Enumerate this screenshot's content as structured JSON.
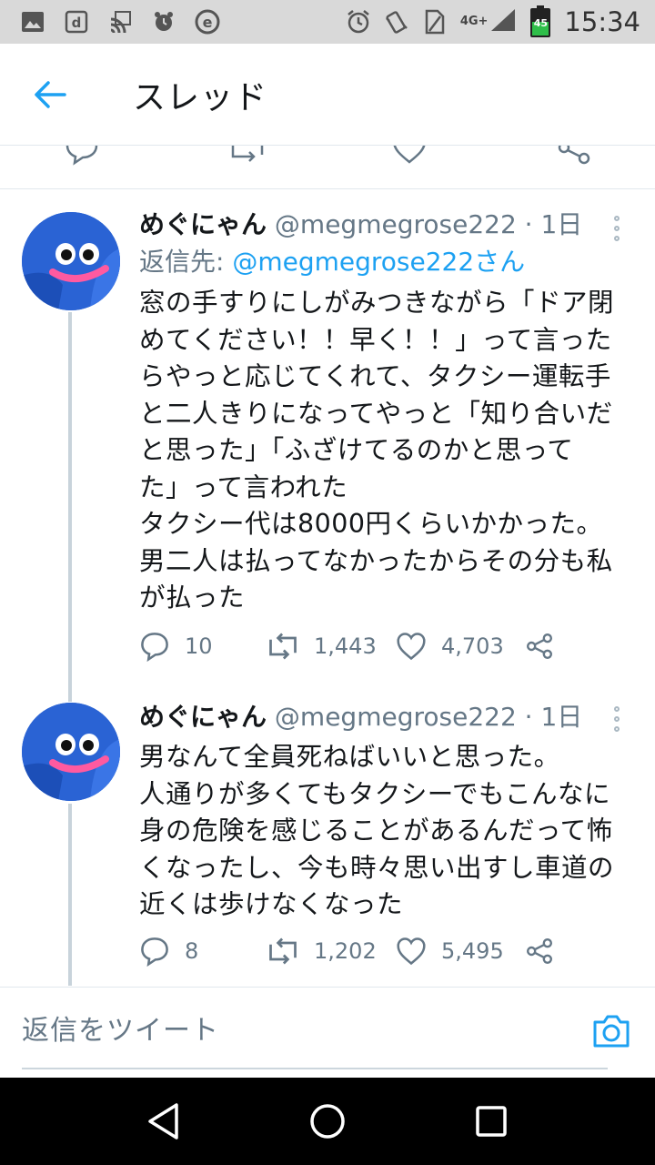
{
  "status_bar": {
    "time": "15:34",
    "network": "4G+",
    "battery": "45"
  },
  "header": {
    "title": "スレッド"
  },
  "tweets": [
    {
      "author_name": "めぐにゃん",
      "handle": "@megmegrose222",
      "time": "· 1日",
      "reply_label": "返信先:",
      "reply_handle": "@megmegrose222さん",
      "text": "窓の手すりにしがみつきながら「ドア閉\nめてください！！早く！！」って言った\nらやっと応じてくれて、タクシー運転手\nと二人きりになってやっと「知り合いだ\nと思った」「ふざけてるのかと思って\nた」って言われた\nタクシー代は8000円くらいかかった。\n男二人は払ってなかったからその分も私\nが払った",
      "replies": "10",
      "retweets": "1,443",
      "likes": "4,703"
    },
    {
      "author_name": "めぐにゃん",
      "handle": "@megmegrose222",
      "time": "· 1日",
      "text": "男なんて全員死ねばいいと思った。\n人通りが多くてもタクシーでもこんなに\n身の危険を感じることがあるんだって怖\nくなったし、今も時々思い出すし車道の\n近くは歩けなくなった",
      "replies": "8",
      "retweets": "1,202",
      "likes": "5,495"
    }
  ],
  "composer": {
    "placeholder": "返信をツイート"
  },
  "colors": {
    "accent": "#1da1f2",
    "text": "#14171a",
    "secondary": "#657786"
  },
  "icons": [
    "gallery-icon",
    "docomo-icon",
    "cast-icon",
    "alarm-icon",
    "e-icon",
    "alarm-clock-icon",
    "vibrate-icon",
    "sim-icon",
    "signal-icon",
    "battery-icon",
    "back-arrow-icon",
    "reply-icon",
    "retweet-icon",
    "like-icon",
    "share-icon",
    "more-icon",
    "camera-icon",
    "nav-back-icon",
    "nav-home-icon",
    "nav-recents-icon"
  ]
}
